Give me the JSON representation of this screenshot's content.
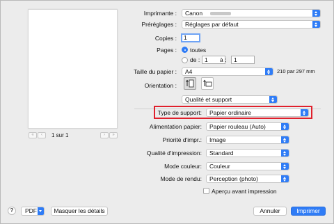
{
  "printer": {
    "label": "Imprimante :",
    "value": "Canon"
  },
  "presets": {
    "label": "Préréglages :",
    "value": "Réglages par défaut"
  },
  "copies": {
    "label": "Copies :",
    "value": "1"
  },
  "pages": {
    "label": "Pages :",
    "all_label": "toutes",
    "from_label": "de :",
    "from_value": "1",
    "to_label": "à :",
    "to_value": "1",
    "selected": "all"
  },
  "paper_size": {
    "label": "Taille du papier :",
    "value": "A4",
    "dimensions": "210 par 297 mm"
  },
  "orientation": {
    "label": "Orientation :",
    "selected": "portrait"
  },
  "section": {
    "value": "Qualité et support"
  },
  "media_type": {
    "label": "Type de support:",
    "value": "Papier ordinaire"
  },
  "paper_source": {
    "label": "Alimentation papier:",
    "value": "Papier rouleau (Auto)"
  },
  "priority": {
    "label": "Priorité d'impr.:",
    "value": "Image"
  },
  "quality": {
    "label": "Qualité d'impression:",
    "value": "Standard"
  },
  "color_mode": {
    "label": "Mode couleur:",
    "value": "Couleur"
  },
  "rendering": {
    "label": "Mode de rendu:",
    "value": "Perception (photo)"
  },
  "preview_checkbox": {
    "label": "Aperçu avant impression",
    "checked": false
  },
  "pager": {
    "text": "1 sur 1",
    "first": "«",
    "prev": "‹",
    "next": "›",
    "last": "»"
  },
  "footer": {
    "help": "?",
    "pdf": "PDF",
    "hide_details": "Masquer les détails",
    "cancel": "Annuler",
    "print": "Imprimer"
  },
  "colors": {
    "accent": "#2f7cf6",
    "highlight": "#e0202c"
  }
}
